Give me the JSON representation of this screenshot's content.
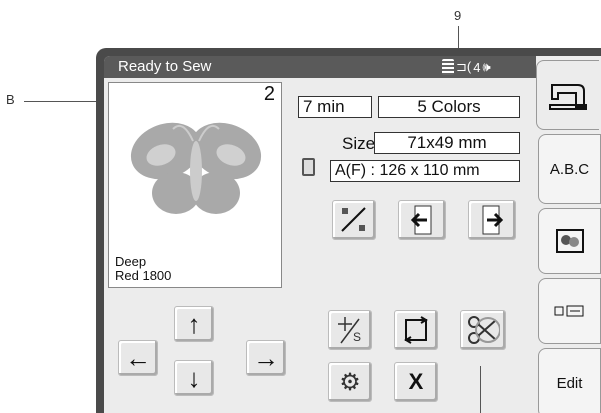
{
  "callouts": {
    "b": "B",
    "nine": "9"
  },
  "title": "Ready to Sew",
  "status": {
    "presser_icon": "presser-foot-icon",
    "thread_count": "4",
    "sound_icon": "speaker-icon"
  },
  "preview": {
    "number": "2",
    "color_name_line1": "Deep",
    "color_name_line2": "Red 1800"
  },
  "info": {
    "time": "7 min",
    "colors": "5 Colors",
    "size_label": "Size",
    "size_value": "71x49 mm",
    "hoop": "A(F) : 126 x 110 mm"
  },
  "tabs": {
    "abc": "A.B.C",
    "edit": "Edit"
  },
  "buttons": {
    "cancel": "X"
  },
  "colors": {
    "titlebar": "#5a5a5a",
    "bezel": "#4a4a4a",
    "butterfly_wing": "#a9a9a9",
    "butterfly_inner": "#d0d0d0"
  }
}
